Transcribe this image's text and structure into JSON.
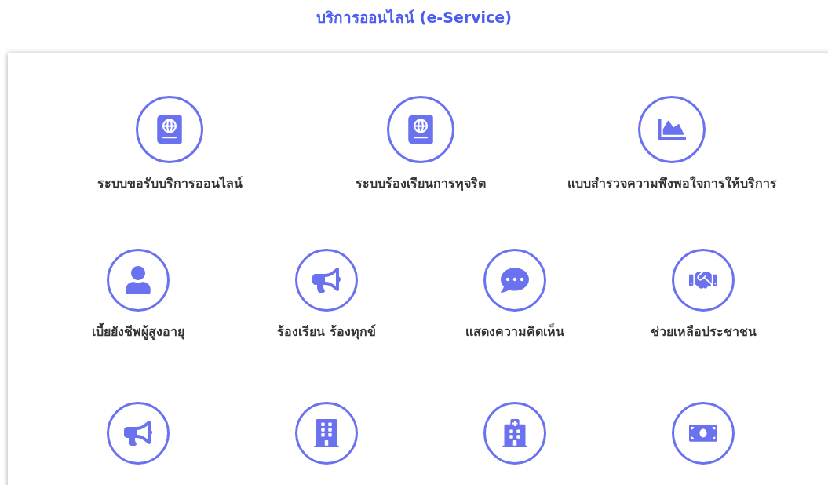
{
  "title": "บริการออนไลน์ (e-Service)",
  "rows": [
    {
      "items": [
        {
          "kind": "labelled",
          "label": "ระบบขอรับบริการออนไลน์"
        },
        {
          "kind": "labelled",
          "label": "ระบบร้องเรียนการทุจริต"
        },
        {
          "kind": "labelled",
          "label": "แบบสำรวจความพึงพอใจการให้บริการ"
        }
      ]
    },
    {
      "items": [
        {
          "kind": "labelled",
          "label": "เบี้ยยังชีพผู้สูงอายุ"
        },
        {
          "kind": "labelled",
          "label": "ร้องเรียน ร้องทุกข์"
        },
        {
          "kind": "labelled",
          "label": "แสดงความคิดเห็น"
        },
        {
          "kind": "labelled",
          "label": "ช่วยเหลือประชาชน"
        }
      ]
    },
    {
      "items": [
        {
          "kind": "icon_only"
        },
        {
          "kind": "icon_only"
        },
        {
          "kind": "icon_only"
        },
        {
          "kind": "icon_only"
        }
      ]
    }
  ]
}
